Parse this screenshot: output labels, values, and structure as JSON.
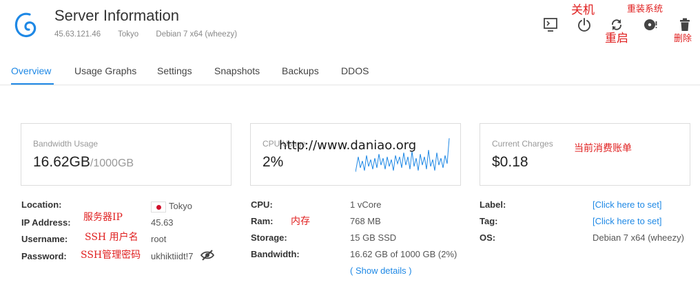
{
  "header": {
    "title": "Server Information",
    "ip": "45.63.121.46",
    "location": "Tokyo",
    "os": "Debian 7 x64 (wheezy)"
  },
  "toolbar": {
    "icons": [
      "console-icon",
      "power-icon",
      "restart-icon",
      "reinstall-icon",
      "trash-icon"
    ]
  },
  "annotations": {
    "shutdown": "关机",
    "reinstall": "重装系统",
    "restart": "重启",
    "delete": "删除",
    "watermark": "http://www.daniao.org",
    "charges": "当前消费账单",
    "location_ip": "服务器IP",
    "username": "SSH 用户名",
    "password": "SSH管理密码",
    "ram": "内存"
  },
  "tabs": [
    "Overview",
    "Usage Graphs",
    "Settings",
    "Snapshots",
    "Backups",
    "DDOS"
  ],
  "cards": {
    "bandwidth": {
      "label": "Bandwidth Usage",
      "value": "16.62GB",
      "suffix": "/1000GB"
    },
    "cpu": {
      "label": "CPU Usage",
      "value": "2%"
    },
    "charges": {
      "label": "Current Charges",
      "value": "$0.18"
    }
  },
  "server": {
    "location_label": "Location:",
    "location_value": "Tokyo",
    "ip_label": "IP Address:",
    "ip_value": "45.63",
    "username_label": "Username:",
    "username_value": "root",
    "password_label": "Password:",
    "password_value": "ukhiktiidt!7"
  },
  "specs": {
    "cpu_label": "CPU:",
    "cpu_value": "1 vCore",
    "ram_label": "Ram:",
    "ram_value": "768 MB",
    "storage_label": "Storage:",
    "storage_value": "15 GB SSD",
    "bandwidth_label": "Bandwidth:",
    "bandwidth_value": "16.62 GB of 1000 GB (2%)",
    "show_details": "( Show details )"
  },
  "meta": {
    "label_label": "Label:",
    "label_value": "[Click here to set]",
    "tag_label": "Tag:",
    "tag_value": "[Click here to set]",
    "os_label": "OS:",
    "os_value": "Debian 7 x64 (wheezy)"
  },
  "colors": {
    "accent": "#1e88e5",
    "annotation": "#e02020",
    "flag_red": "#d0102b"
  }
}
